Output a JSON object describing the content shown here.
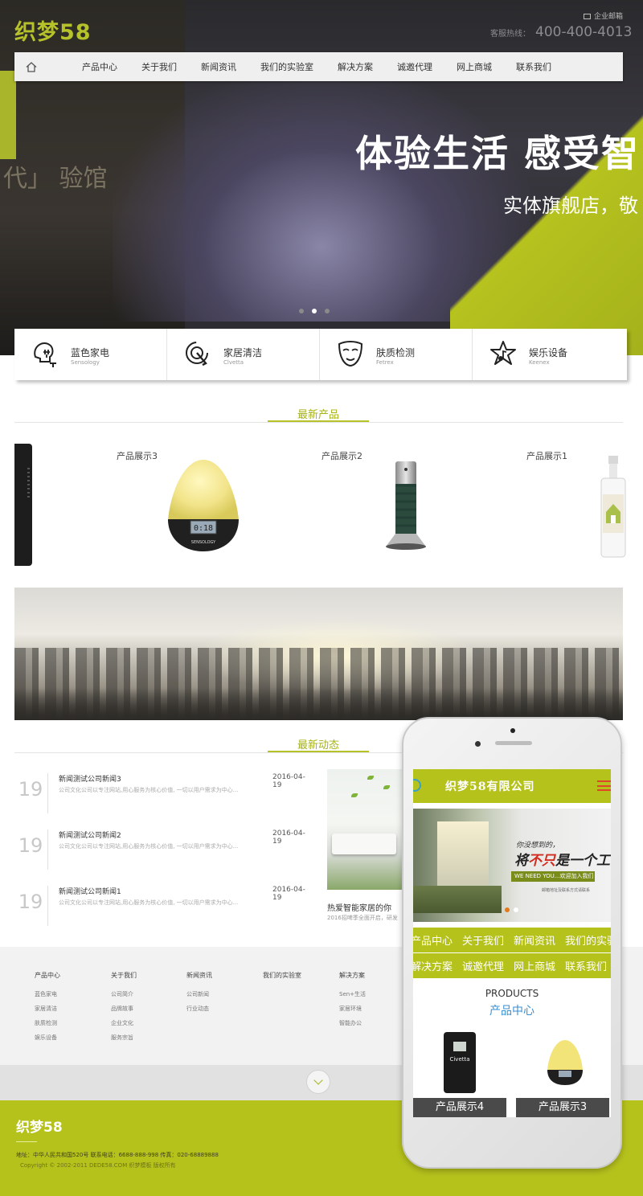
{
  "header": {
    "logo": "织梦58",
    "top_link": "企业邮箱",
    "phone_label": "客服热线：",
    "phone": "400-400-4013"
  },
  "nav": {
    "items": [
      "产品中心",
      "关于我们",
      "新闻资讯",
      "我们的实验室",
      "解决方案",
      "诚邀代理",
      "网上商城",
      "联系我们"
    ]
  },
  "hero": {
    "title": "体验生活  感受智",
    "subtitle": "实体旗舰店，敬",
    "deco": "代」 验馆",
    "slides": 3,
    "active_slide": 2
  },
  "categories": [
    {
      "title": "蓝色家电",
      "sub": "Sensology",
      "icon": "head-plug-icon"
    },
    {
      "title": "家居清洁",
      "sub": "Clvetta",
      "icon": "target-hand-icon"
    },
    {
      "title": "肤质检测",
      "sub": "Fetrex",
      "icon": "face-mask-icon"
    },
    {
      "title": "娱乐设备",
      "sub": "Keenex",
      "icon": "star-note-icon"
    }
  ],
  "products": {
    "title": "最新产品",
    "items": [
      {
        "name": "产品展示3",
        "icon": "egg-lamp-image"
      },
      {
        "name": "产品展示2",
        "icon": "purifier-image"
      },
      {
        "name": "产品展示1",
        "icon": "spray-bottle-image"
      }
    ]
  },
  "news": {
    "title": "最新动态",
    "items": [
      {
        "day": "19",
        "title": "新闻测试公司新闻3",
        "date": "2016-04-19",
        "desc": "公司文化公司以专注网站,用心服务为核心价值, 一切以用户需求为中心..."
      },
      {
        "day": "19",
        "title": "新闻测试公司新闻2",
        "date": "2016-04-19",
        "desc": "公司文化公司以专注网站,用心服务为核心价值, 一切以用户需求为中心..."
      },
      {
        "day": "19",
        "title": "新闻测试公司新闻1",
        "date": "2016-04-19",
        "desc": "公司文化公司以专注网站,用心服务为核心价值, 一切以用户需求为中心..."
      }
    ],
    "feature_caption": "热爱智能家居的你",
    "feature_sub": "2016招啤季全面开启，研发"
  },
  "footer": {
    "columns": [
      {
        "title": "产品中心",
        "items": [
          "蓝色家电",
          "家居清洁",
          "肤质检测",
          "娱乐设备"
        ]
      },
      {
        "title": "关于我们",
        "items": [
          "公司简介",
          "品牌故事",
          "企业文化",
          "服务宗旨"
        ]
      },
      {
        "title": "新闻资讯",
        "items": [
          "公司新闻",
          "行业动态"
        ]
      },
      {
        "title": "我们的实验室",
        "items": []
      },
      {
        "title": "解决方案",
        "items": [
          "Sen+生活",
          "家居环境",
          "智能办公"
        ]
      }
    ],
    "logo": "织梦58",
    "address": "地址：中华人民共和国520号  联系电话：6688-888-998  传真：020-68889888",
    "copyright": "Copyright © 2002-2011 DEDE58.COM 织梦模板 版权所有",
    "side_number": "3"
  },
  "mobile": {
    "logo": "织梦58有限公司",
    "banner_text1": "你没想到的，",
    "banner_text2_a": "将",
    "banner_text2_b": "不只",
    "banner_text2_c": "是一个工作......",
    "banner_tag": "WE NEED YOU...欢迎加入我们",
    "banner_small": "邮箱地址及联系方式请联系",
    "nav_row1": [
      "产品中心",
      "关于我们",
      "新闻资讯",
      "我们的实验"
    ],
    "nav_row2": [
      "解决方案",
      "诚邀代理",
      "网上商城",
      "联系我们"
    ],
    "products_en": "PRODUCTS",
    "products_cn": "产品中心",
    "products": [
      "产品展示4",
      "产品展示3"
    ],
    "speaker_brand": "Civetta"
  },
  "colors": {
    "accent": "#b6c21c",
    "accent_text": "#a5b21a",
    "mobile_blue": "#3a8fd0",
    "menu_red": "#e0452a"
  }
}
